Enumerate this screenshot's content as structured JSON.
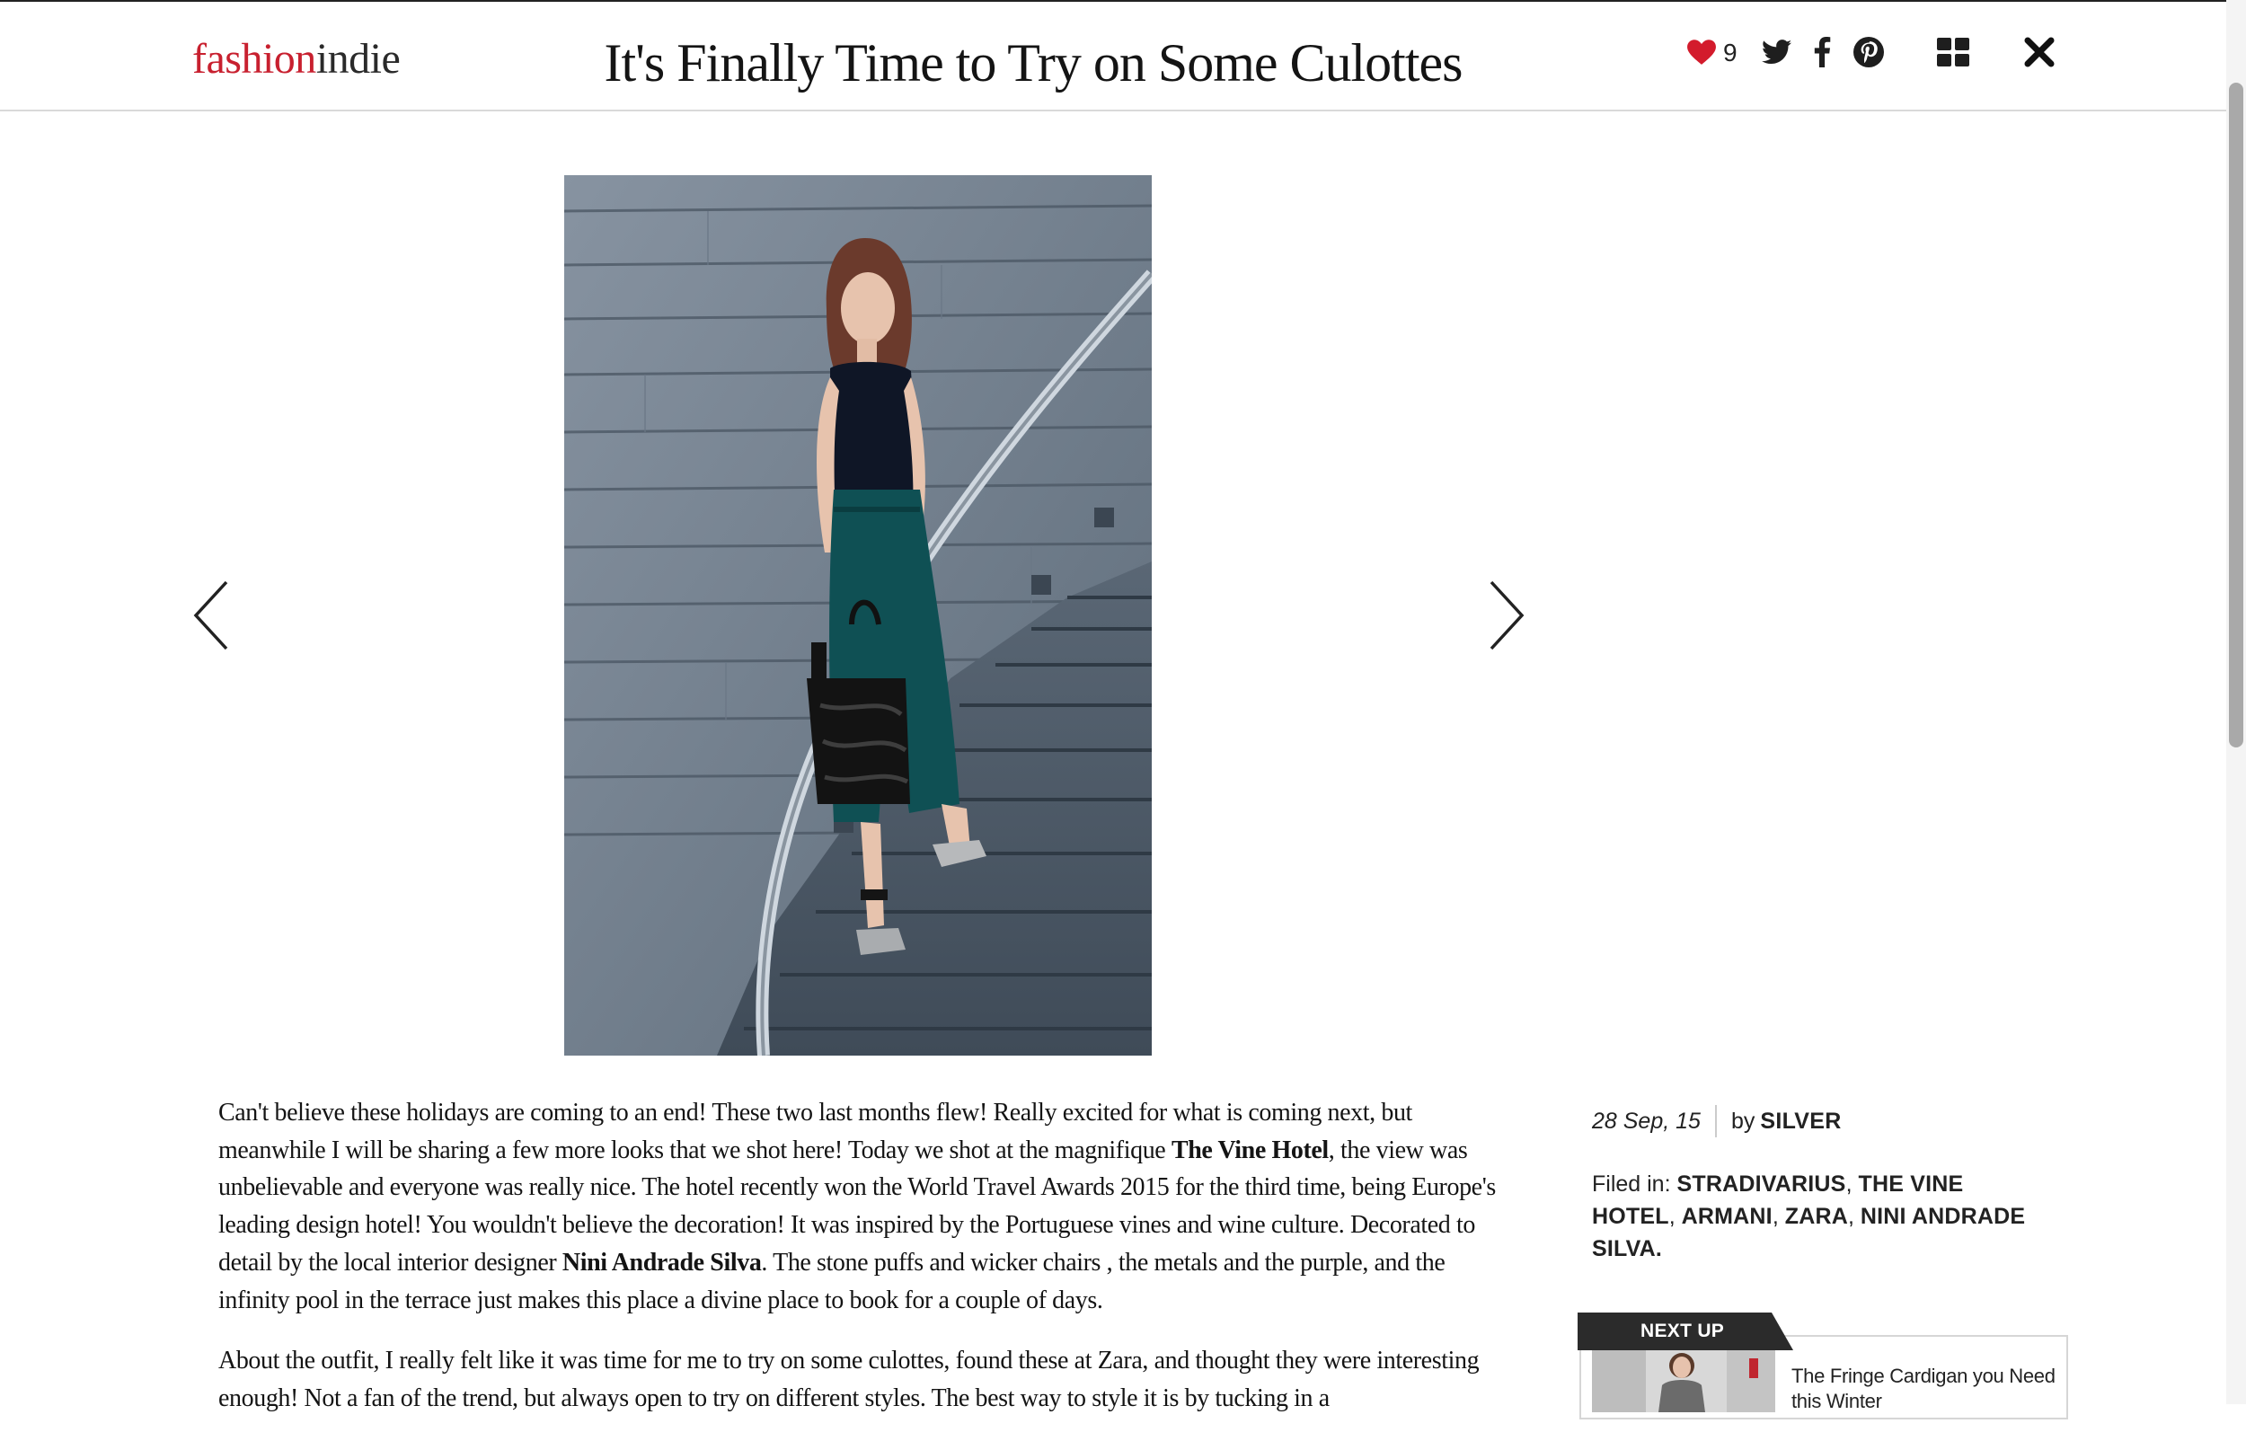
{
  "header": {
    "logo_part1": "fashion",
    "logo_part2": "indie",
    "title": "It's Finally Time to Try on Some Culottes",
    "like_count": "9",
    "icons": [
      "heart-icon",
      "twitter-icon",
      "facebook-icon",
      "pinterest-icon",
      "grid-icon",
      "close-icon"
    ]
  },
  "gallery": {
    "prev_icon": "chevron-left-icon",
    "next_icon": "chevron-right-icon"
  },
  "article": {
    "p1_a": "Can't believe these holidays are coming to an end! These two last months flew! Really excited for what is coming next, but meanwhile I will be sharing a few more looks that we shot here! Today we shot at the magnifique ",
    "p1_b": "The Vine Hotel",
    "p1_c": ", the view was unbelievable and everyone was really nice. The hotel recently won the World Travel Awards 2015 for the third time, being Europe's leading design hotel! You wouldn't believe the decoration! It was inspired by the Portuguese vines and wine culture. Decorated to detail by the local interior designer ",
    "p1_d": "Nini Andrade Silva",
    "p1_e": ". The stone puffs and wicker chairs , the metals and the purple, and the infinity pool in the terrace just makes this place a divine place to book for a couple of days.",
    "p2": "About the outfit, I really felt like it was time for me to try on some culottes, found these at Zara, and thought they were interesting enough! Not a fan of the trend, but always open to try on different styles. The best way to style it is by tucking in a"
  },
  "sidebar": {
    "date": "28 Sep, 15",
    "by_label": "by",
    "author": "SILVER",
    "filed_label": "Filed in:",
    "tags": [
      "STRADIVARIUS",
      "THE VINE HOTEL",
      "ARMANI",
      "ZARA",
      "NINI ANDRADE SILVA."
    ],
    "next_up_label": "NEXT UP",
    "next_up_title": "The Fringe Cardigan you Need this Winter"
  },
  "colors": {
    "brand_red": "#c8202f",
    "text": "#141414",
    "photo_wall": "#6f7e8d"
  }
}
